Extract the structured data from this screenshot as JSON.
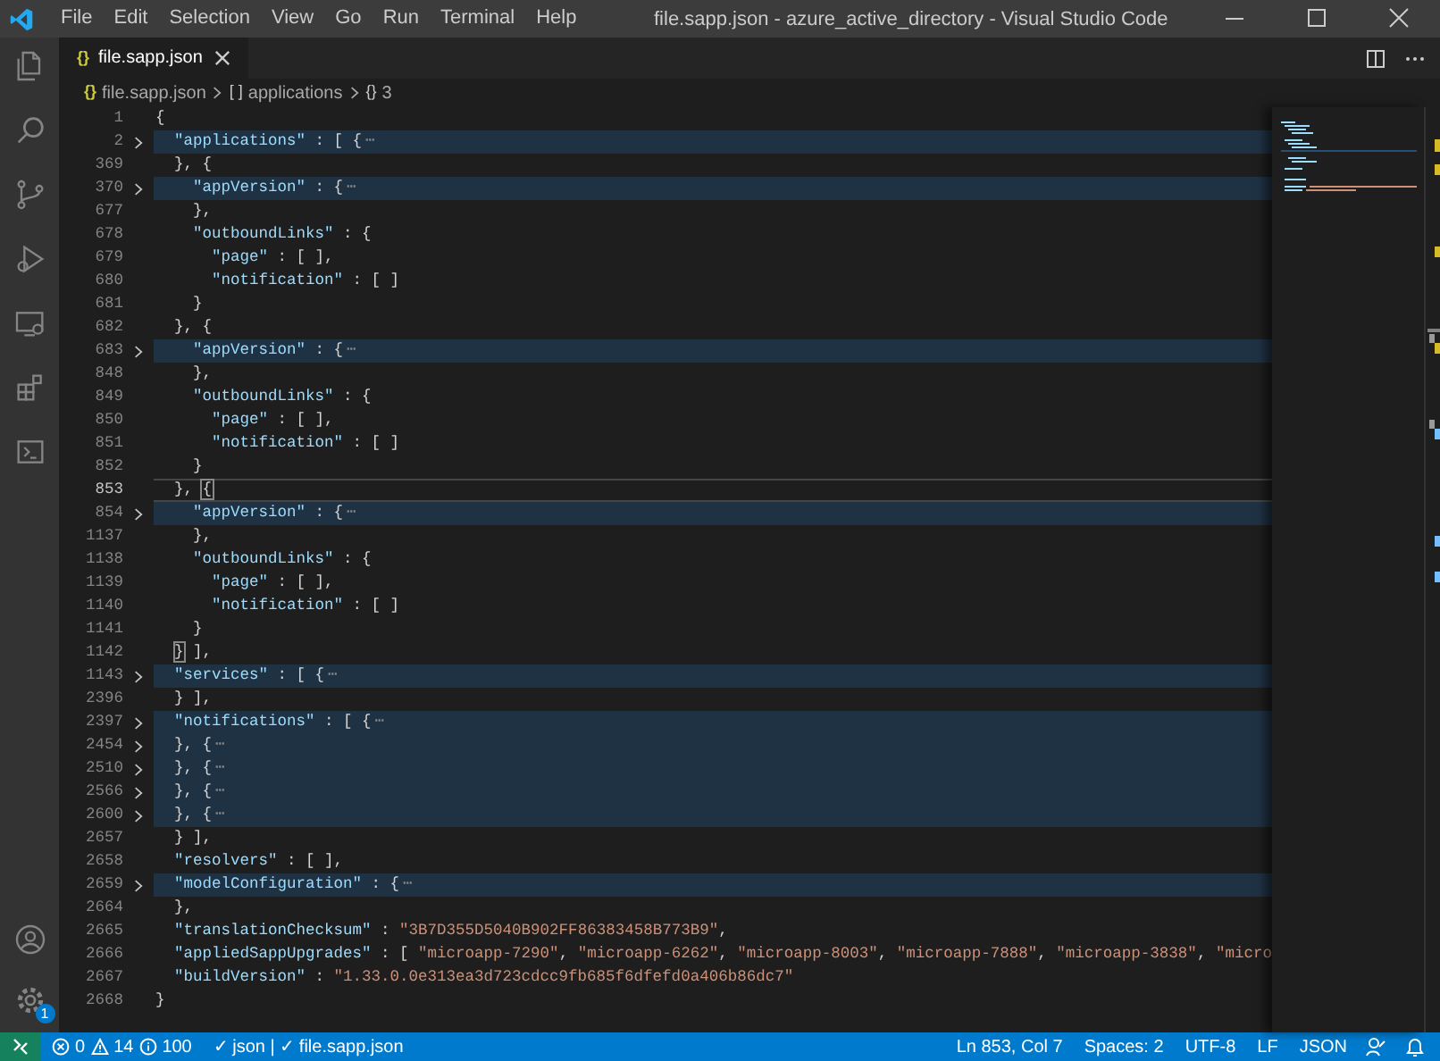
{
  "window": {
    "title": "file.sapp.json - azure_active_directory - Visual Studio Code"
  },
  "menu": [
    "File",
    "Edit",
    "Selection",
    "View",
    "Go",
    "Run",
    "Terminal",
    "Help"
  ],
  "activity_bar": {
    "settings_badge": "1"
  },
  "tabs": [
    {
      "label": "file.sapp.json",
      "icon": "{}",
      "selected": true
    }
  ],
  "breadcrumb": [
    {
      "icon": "{}",
      "label": "file.sapp.json"
    },
    {
      "icon": "[ ]",
      "label": "applications"
    },
    {
      "icon": "{}",
      "label": "3"
    }
  ],
  "lines": [
    {
      "number": "1",
      "folded": false,
      "current": false,
      "tokens": [
        {
          "kind": "punct",
          "text": "{"
        }
      ]
    },
    {
      "number": "2",
      "folded": true,
      "current": false,
      "tokens": [
        {
          "kind": "key",
          "text": "  \"applications\""
        },
        {
          "kind": "punct",
          "text": " : [ {"
        },
        {
          "kind": "ellipsis",
          "text": "⋯"
        }
      ]
    },
    {
      "number": "369",
      "folded": false,
      "current": false,
      "tokens": [
        {
          "kind": "punct",
          "text": "  }, {"
        }
      ]
    },
    {
      "number": "370",
      "folded": true,
      "current": false,
      "tokens": [
        {
          "kind": "key",
          "text": "    \"appVersion\""
        },
        {
          "kind": "punct",
          "text": " : {"
        },
        {
          "kind": "ellipsis",
          "text": "⋯"
        }
      ]
    },
    {
      "number": "677",
      "folded": false,
      "current": false,
      "tokens": [
        {
          "kind": "punct",
          "text": "    },"
        }
      ]
    },
    {
      "number": "678",
      "folded": false,
      "current": false,
      "tokens": [
        {
          "kind": "key",
          "text": "    \"outboundLinks\""
        },
        {
          "kind": "punct",
          "text": " : {"
        }
      ]
    },
    {
      "number": "679",
      "folded": false,
      "current": false,
      "tokens": [
        {
          "kind": "key",
          "text": "      \"page\""
        },
        {
          "kind": "punct",
          "text": " : [ ],"
        }
      ]
    },
    {
      "number": "680",
      "folded": false,
      "current": false,
      "tokens": [
        {
          "kind": "key",
          "text": "      \"notification\""
        },
        {
          "kind": "punct",
          "text": " : [ ]"
        }
      ]
    },
    {
      "number": "681",
      "folded": false,
      "current": false,
      "tokens": [
        {
          "kind": "punct",
          "text": "    }"
        }
      ]
    },
    {
      "number": "682",
      "folded": false,
      "current": false,
      "tokens": [
        {
          "kind": "punct",
          "text": "  }, {"
        }
      ]
    },
    {
      "number": "683",
      "folded": true,
      "current": false,
      "tokens": [
        {
          "kind": "key",
          "text": "    \"appVersion\""
        },
        {
          "kind": "punct",
          "text": " : {"
        },
        {
          "kind": "ellipsis",
          "text": "⋯"
        }
      ]
    },
    {
      "number": "848",
      "folded": false,
      "current": false,
      "tokens": [
        {
          "kind": "punct",
          "text": "    },"
        }
      ]
    },
    {
      "number": "849",
      "folded": false,
      "current": false,
      "tokens": [
        {
          "kind": "key",
          "text": "    \"outboundLinks\""
        },
        {
          "kind": "punct",
          "text": " : {"
        }
      ]
    },
    {
      "number": "850",
      "folded": false,
      "current": false,
      "tokens": [
        {
          "kind": "key",
          "text": "      \"page\""
        },
        {
          "kind": "punct",
          "text": " : [ ],"
        }
      ]
    },
    {
      "number": "851",
      "folded": false,
      "current": false,
      "tokens": [
        {
          "kind": "key",
          "text": "      \"notification\""
        },
        {
          "kind": "punct",
          "text": " : [ ]"
        }
      ]
    },
    {
      "number": "852",
      "folded": false,
      "current": false,
      "tokens": [
        {
          "kind": "punct",
          "text": "    }"
        }
      ]
    },
    {
      "number": "853",
      "folded": false,
      "current": true,
      "tokens": [
        {
          "kind": "punct",
          "text": "  }, "
        },
        {
          "kind": "match",
          "text": "{"
        }
      ]
    },
    {
      "number": "854",
      "folded": true,
      "current": false,
      "tokens": [
        {
          "kind": "key",
          "text": "    \"appVersion\""
        },
        {
          "kind": "punct",
          "text": " : {"
        },
        {
          "kind": "ellipsis",
          "text": "⋯"
        }
      ]
    },
    {
      "number": "1137",
      "folded": false,
      "current": false,
      "tokens": [
        {
          "kind": "punct",
          "text": "    },"
        }
      ]
    },
    {
      "number": "1138",
      "folded": false,
      "current": false,
      "tokens": [
        {
          "kind": "key",
          "text": "    \"outboundLinks\""
        },
        {
          "kind": "punct",
          "text": " : {"
        }
      ]
    },
    {
      "number": "1139",
      "folded": false,
      "current": false,
      "tokens": [
        {
          "kind": "key",
          "text": "      \"page\""
        },
        {
          "kind": "punct",
          "text": " : [ ],"
        }
      ]
    },
    {
      "number": "1140",
      "folded": false,
      "current": false,
      "tokens": [
        {
          "kind": "key",
          "text": "      \"notification\""
        },
        {
          "kind": "punct",
          "text": " : [ ]"
        }
      ]
    },
    {
      "number": "1141",
      "folded": false,
      "current": false,
      "tokens": [
        {
          "kind": "punct",
          "text": "    }"
        }
      ]
    },
    {
      "number": "1142",
      "folded": false,
      "current": false,
      "tokens": [
        {
          "kind": "match",
          "text": "  }"
        },
        {
          "kind": "punct",
          "text": " ],"
        }
      ]
    },
    {
      "number": "1143",
      "folded": true,
      "current": false,
      "tokens": [
        {
          "kind": "key",
          "text": "  \"services\""
        },
        {
          "kind": "punct",
          "text": " : [ {"
        },
        {
          "kind": "ellipsis",
          "text": "⋯"
        }
      ]
    },
    {
      "number": "2396",
      "folded": false,
      "current": false,
      "tokens": [
        {
          "kind": "punct",
          "text": "  } ],"
        }
      ]
    },
    {
      "number": "2397",
      "folded": true,
      "current": false,
      "tokens": [
        {
          "kind": "key",
          "text": "  \"notifications\""
        },
        {
          "kind": "punct",
          "text": " : [ {"
        },
        {
          "kind": "ellipsis",
          "text": "⋯"
        }
      ]
    },
    {
      "number": "2454",
      "folded": true,
      "current": false,
      "tokens": [
        {
          "kind": "punct",
          "text": "  }, {"
        },
        {
          "kind": "ellipsis",
          "text": "⋯"
        }
      ]
    },
    {
      "number": "2510",
      "folded": true,
      "current": false,
      "tokens": [
        {
          "kind": "punct",
          "text": "  }, {"
        },
        {
          "kind": "ellipsis",
          "text": "⋯"
        }
      ]
    },
    {
      "number": "2566",
      "folded": true,
      "current": false,
      "tokens": [
        {
          "kind": "punct",
          "text": "  }, {"
        },
        {
          "kind": "ellipsis",
          "text": "⋯"
        }
      ]
    },
    {
      "number": "2600",
      "folded": true,
      "current": false,
      "tokens": [
        {
          "kind": "punct",
          "text": "  }, {"
        },
        {
          "kind": "ellipsis",
          "text": "⋯"
        }
      ]
    },
    {
      "number": "2657",
      "folded": false,
      "current": false,
      "tokens": [
        {
          "kind": "punct",
          "text": "  } ],"
        }
      ]
    },
    {
      "number": "2658",
      "folded": false,
      "current": false,
      "tokens": [
        {
          "kind": "key",
          "text": "  \"resolvers\""
        },
        {
          "kind": "punct",
          "text": " : [ ],"
        }
      ]
    },
    {
      "number": "2659",
      "folded": true,
      "current": false,
      "tokens": [
        {
          "kind": "key",
          "text": "  \"modelConfiguration\""
        },
        {
          "kind": "punct",
          "text": " : {"
        },
        {
          "kind": "ellipsis",
          "text": "⋯"
        }
      ]
    },
    {
      "number": "2664",
      "folded": false,
      "current": false,
      "tokens": [
        {
          "kind": "punct",
          "text": "  },"
        }
      ]
    },
    {
      "number": "2665",
      "folded": false,
      "current": false,
      "tokens": [
        {
          "kind": "key",
          "text": "  \"translationChecksum\""
        },
        {
          "kind": "punct",
          "text": " : "
        },
        {
          "kind": "string",
          "text": "\"3B7D355D5040B902FF86383458B773B9\""
        },
        {
          "kind": "punct",
          "text": ","
        }
      ]
    },
    {
      "number": "2666",
      "folded": false,
      "current": false,
      "tokens": [
        {
          "kind": "key",
          "text": "  \"appliedSappUpgrades\""
        },
        {
          "kind": "punct",
          "text": " : [ "
        },
        {
          "kind": "string",
          "text": "\"microapp-7290\""
        },
        {
          "kind": "punct",
          "text": ", "
        },
        {
          "kind": "string",
          "text": "\"microapp-6262\""
        },
        {
          "kind": "punct",
          "text": ", "
        },
        {
          "kind": "string",
          "text": "\"microapp-8003\""
        },
        {
          "kind": "punct",
          "text": ", "
        },
        {
          "kind": "string",
          "text": "\"microapp-7888\""
        },
        {
          "kind": "punct",
          "text": ", "
        },
        {
          "kind": "string",
          "text": "\"microapp-3838\""
        },
        {
          "kind": "punct",
          "text": ", "
        },
        {
          "kind": "string",
          "text": "\"micro"
        }
      ]
    },
    {
      "number": "2667",
      "folded": false,
      "current": false,
      "tokens": [
        {
          "kind": "key",
          "text": "  \"buildVersion\""
        },
        {
          "kind": "punct",
          "text": " : "
        },
        {
          "kind": "string",
          "text": "\"1.33.0.0e313ea3d723cdcc9fb685f6dfefd0a406b86dc7\""
        }
      ]
    },
    {
      "number": "2668",
      "folded": false,
      "current": false,
      "tokens": [
        {
          "kind": "punct",
          "text": "}"
        }
      ]
    }
  ],
  "status_bar": {
    "errors": "0",
    "warnings": "14",
    "infos": "100",
    "left": [
      "✓ json | ✓ file.sapp.json"
    ],
    "right": [
      "Ln 853, Col 7",
      "Spaces: 2",
      "UTF-8",
      "LF",
      "JSON"
    ]
  }
}
